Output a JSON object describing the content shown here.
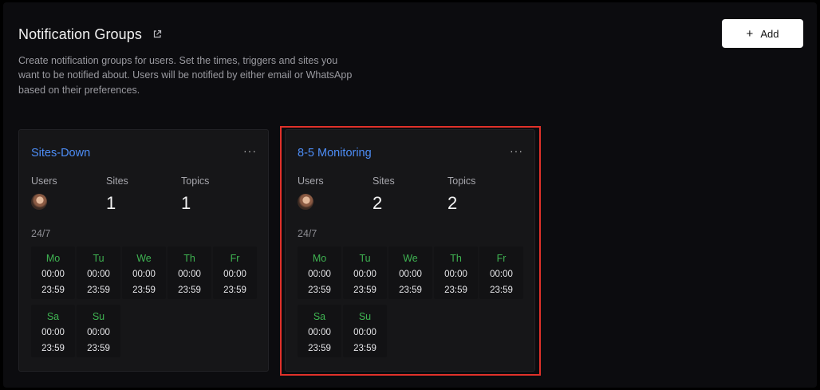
{
  "page": {
    "title": "Notification Groups",
    "description": "Create notification groups for users. Set the times, triggers and sites you want to be notified about. Users will be notified by either email or WhatsApp based on their preferences.",
    "add_button_label": "Add"
  },
  "icons": {
    "external_link": "external-link-icon",
    "plus": "plus-icon",
    "more": "more-horizontal-icon"
  },
  "colors": {
    "title_link": "#4d8df6",
    "day_name": "#3fb452",
    "selection_outline": "#e0312a"
  },
  "groups": [
    {
      "name": "Sites-Down",
      "menu": "···",
      "users_label": "Users",
      "sites_label": "Sites",
      "sites_count": "1",
      "topics_label": "Topics",
      "topics_count": "1",
      "schedule": "24/7",
      "days": [
        {
          "name": "Mo",
          "start": "00:00",
          "end": "23:59"
        },
        {
          "name": "Tu",
          "start": "00:00",
          "end": "23:59"
        },
        {
          "name": "We",
          "start": "00:00",
          "end": "23:59"
        },
        {
          "name": "Th",
          "start": "00:00",
          "end": "23:59"
        },
        {
          "name": "Fr",
          "start": "00:00",
          "end": "23:59"
        },
        {
          "name": "Sa",
          "start": "00:00",
          "end": "23:59"
        },
        {
          "name": "Su",
          "start": "00:00",
          "end": "23:59"
        }
      ]
    },
    {
      "name": "8-5 Monitoring",
      "menu": "···",
      "users_label": "Users",
      "sites_label": "Sites",
      "sites_count": "2",
      "topics_label": "Topics",
      "topics_count": "2",
      "schedule": "24/7",
      "days": [
        {
          "name": "Mo",
          "start": "00:00",
          "end": "23:59"
        },
        {
          "name": "Tu",
          "start": "00:00",
          "end": "23:59"
        },
        {
          "name": "We",
          "start": "00:00",
          "end": "23:59"
        },
        {
          "name": "Th",
          "start": "00:00",
          "end": "23:59"
        },
        {
          "name": "Fr",
          "start": "00:00",
          "end": "23:59"
        },
        {
          "name": "Sa",
          "start": "00:00",
          "end": "23:59"
        },
        {
          "name": "Su",
          "start": "00:00",
          "end": "23:59"
        }
      ]
    }
  ]
}
